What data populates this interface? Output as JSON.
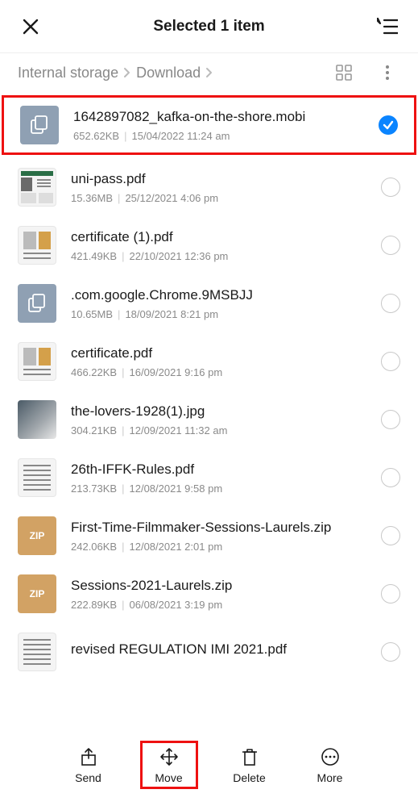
{
  "header": {
    "title": "Selected 1 item"
  },
  "breadcrumb": {
    "root": "Internal storage",
    "folder": "Download"
  },
  "files": [
    {
      "name": "1642897082_kafka-on-the-shore.mobi",
      "size": "652.62KB",
      "date": "15/04/2022 11:24 am",
      "thumb": "generic",
      "selected": true
    },
    {
      "name": "uni-pass.pdf",
      "size": "15.36MB",
      "date": "25/12/2021 4:06 pm",
      "thumb": "pdf-simple",
      "selected": false
    },
    {
      "name": "certificate (1).pdf",
      "size": "421.49KB",
      "date": "22/10/2021 12:36 pm",
      "thumb": "pdf-2col",
      "selected": false
    },
    {
      "name": ".com.google.Chrome.9MSBJJ",
      "size": "10.65MB",
      "date": "18/09/2021 8:21 pm",
      "thumb": "generic",
      "selected": false
    },
    {
      "name": "certificate.pdf",
      "size": "466.22KB",
      "date": "16/09/2021 9:16 pm",
      "thumb": "pdf-2col",
      "selected": false
    },
    {
      "name": "the-lovers-1928(1).jpg",
      "size": "304.21KB",
      "date": "12/09/2021 11:32 am",
      "thumb": "image",
      "selected": false
    },
    {
      "name": "26th-IFFK-Rules.pdf",
      "size": "213.73KB",
      "date": "12/08/2021 9:58 pm",
      "thumb": "pdf-text",
      "selected": false
    },
    {
      "name": "First-Time-Filmmaker-Sessions-Laurels.zip",
      "size": "242.06KB",
      "date": "12/08/2021 2:01 pm",
      "thumb": "zip",
      "selected": false
    },
    {
      "name": "Sessions-2021-Laurels.zip",
      "size": "222.89KB",
      "date": "06/08/2021 3:19 pm",
      "thumb": "zip",
      "selected": false
    },
    {
      "name": "revised REGULATION IMI 2021.pdf",
      "size": "",
      "date": "",
      "thumb": "pdf-text",
      "selected": false
    }
  ],
  "thumb_labels": {
    "zip": "ZIP"
  },
  "toolbar": {
    "send": "Send",
    "move": "Move",
    "delete": "Delete",
    "more": "More"
  },
  "sep": "|"
}
